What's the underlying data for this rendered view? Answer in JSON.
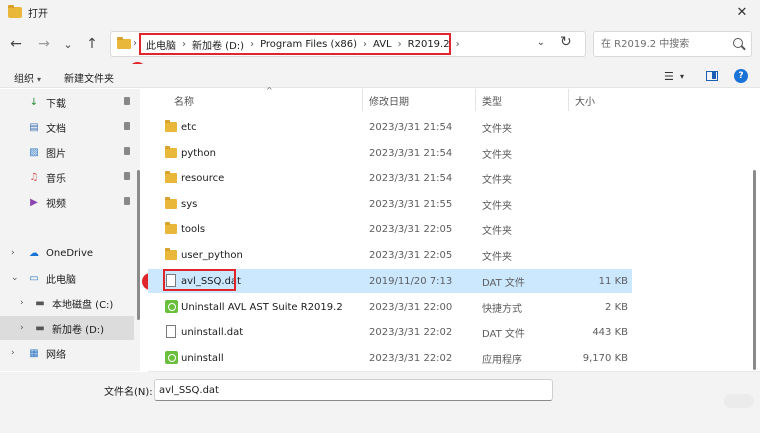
{
  "window": {
    "title": "打开",
    "close_glyph": "✕"
  },
  "nav": {
    "back_glyph": "←",
    "forward_glyph": "→",
    "recent_glyph": "⌄",
    "up_glyph": "↑",
    "refresh_glyph": "↻"
  },
  "address": {
    "crumbs": [
      "此电脑",
      "新加卷 (D:)",
      "Program Files (x86)",
      "AVL",
      "R2019.2"
    ],
    "separator": "›",
    "dropdown_glyph": "⌄"
  },
  "search": {
    "placeholder": "在 R2019.2 中搜索"
  },
  "annotations": {
    "badge1": "1",
    "badge2": "2",
    "color": "#e0262a"
  },
  "commands": {
    "organize": "组织",
    "organize_dd": "▾",
    "new_folder": "新建文件夹",
    "view_glyph": "☰",
    "view_dd": "▾",
    "help": "?"
  },
  "sidebar": {
    "quick_access": [
      {
        "label": "下载",
        "icon": "download-icon",
        "glyph": "↓"
      },
      {
        "label": "文档",
        "icon": "document-icon",
        "glyph": "▤"
      },
      {
        "label": "图片",
        "icon": "pictures-icon",
        "glyph": "▨"
      },
      {
        "label": "音乐",
        "icon": "music-icon",
        "glyph": "♫"
      },
      {
        "label": "视频",
        "icon": "video-icon",
        "glyph": "▶"
      }
    ],
    "tree": [
      {
        "label": "OneDrive",
        "expanded": false
      },
      {
        "label": "此电脑",
        "expanded": true
      },
      {
        "label": "本地磁盘 (C:)",
        "expanded": false
      },
      {
        "label": "新加卷 (D:)",
        "expanded": false,
        "selected": true
      },
      {
        "label": "网络",
        "expanded": false
      }
    ]
  },
  "columns": {
    "name": "名称",
    "modified": "修改日期",
    "type": "类型",
    "size": "大小",
    "sort_glyph": "^"
  },
  "files": [
    {
      "name": "etc",
      "modified": "2023/3/31 21:54",
      "type": "文件夹",
      "size": "",
      "kind": "folder"
    },
    {
      "name": "python",
      "modified": "2023/3/31 21:54",
      "type": "文件夹",
      "size": "",
      "kind": "folder"
    },
    {
      "name": "resource",
      "modified": "2023/3/31 21:54",
      "type": "文件夹",
      "size": "",
      "kind": "folder"
    },
    {
      "name": "sys",
      "modified": "2023/3/31 21:55",
      "type": "文件夹",
      "size": "",
      "kind": "folder"
    },
    {
      "name": "tools",
      "modified": "2023/3/31 22:05",
      "type": "文件夹",
      "size": "",
      "kind": "folder"
    },
    {
      "name": "user_python",
      "modified": "2023/3/31 22:05",
      "type": "文件夹",
      "size": "",
      "kind": "folder"
    },
    {
      "name": "avl_SSQ.dat",
      "modified": "2019/11/20 7:13",
      "type": "DAT 文件",
      "size": "11 KB",
      "kind": "doc",
      "selected": true
    },
    {
      "name": "Uninstall AVL AST Suite R2019.2",
      "modified": "2023/3/31 22:00",
      "type": "快捷方式",
      "size": "2 KB",
      "kind": "app"
    },
    {
      "name": "uninstall.dat",
      "modified": "2023/3/31 22:02",
      "type": "DAT 文件",
      "size": "443 KB",
      "kind": "doc"
    },
    {
      "name": "uninstall",
      "modified": "2023/3/31 22:02",
      "type": "应用程序",
      "size": "9,170 KB",
      "kind": "app"
    }
  ],
  "filename": {
    "label": "文件名(N):",
    "value": "avl_SSQ.dat"
  }
}
